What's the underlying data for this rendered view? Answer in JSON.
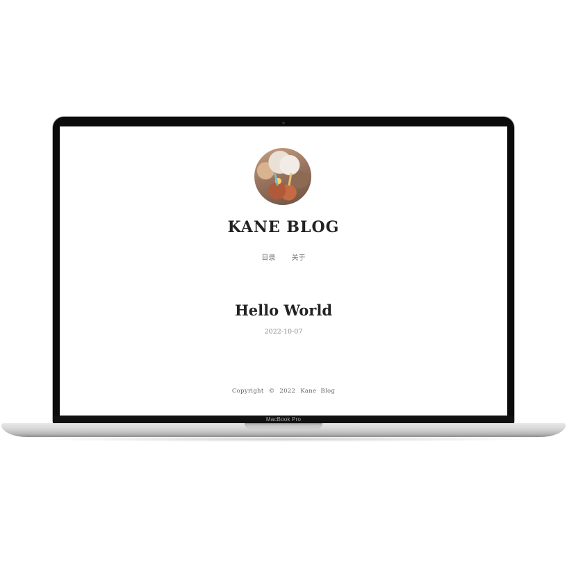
{
  "device": {
    "model_label": "MacBook Pro"
  },
  "blog": {
    "avatar": "avatar-photo",
    "title": "KANE BLOG",
    "nav": [
      {
        "label": "目录",
        "icon": ""
      },
      {
        "label": "关于",
        "icon": ""
      }
    ]
  },
  "posts": [
    {
      "title": "Hello World",
      "date": "2022-10-07"
    }
  ],
  "footer": {
    "copyright_word": "Copyright",
    "copyright_symbol": "©",
    "year": "2022",
    "owner": "Kane  Blog"
  },
  "colors": {
    "text": "#222222",
    "muted": "#888888",
    "bezel": "#0b0b0b"
  }
}
